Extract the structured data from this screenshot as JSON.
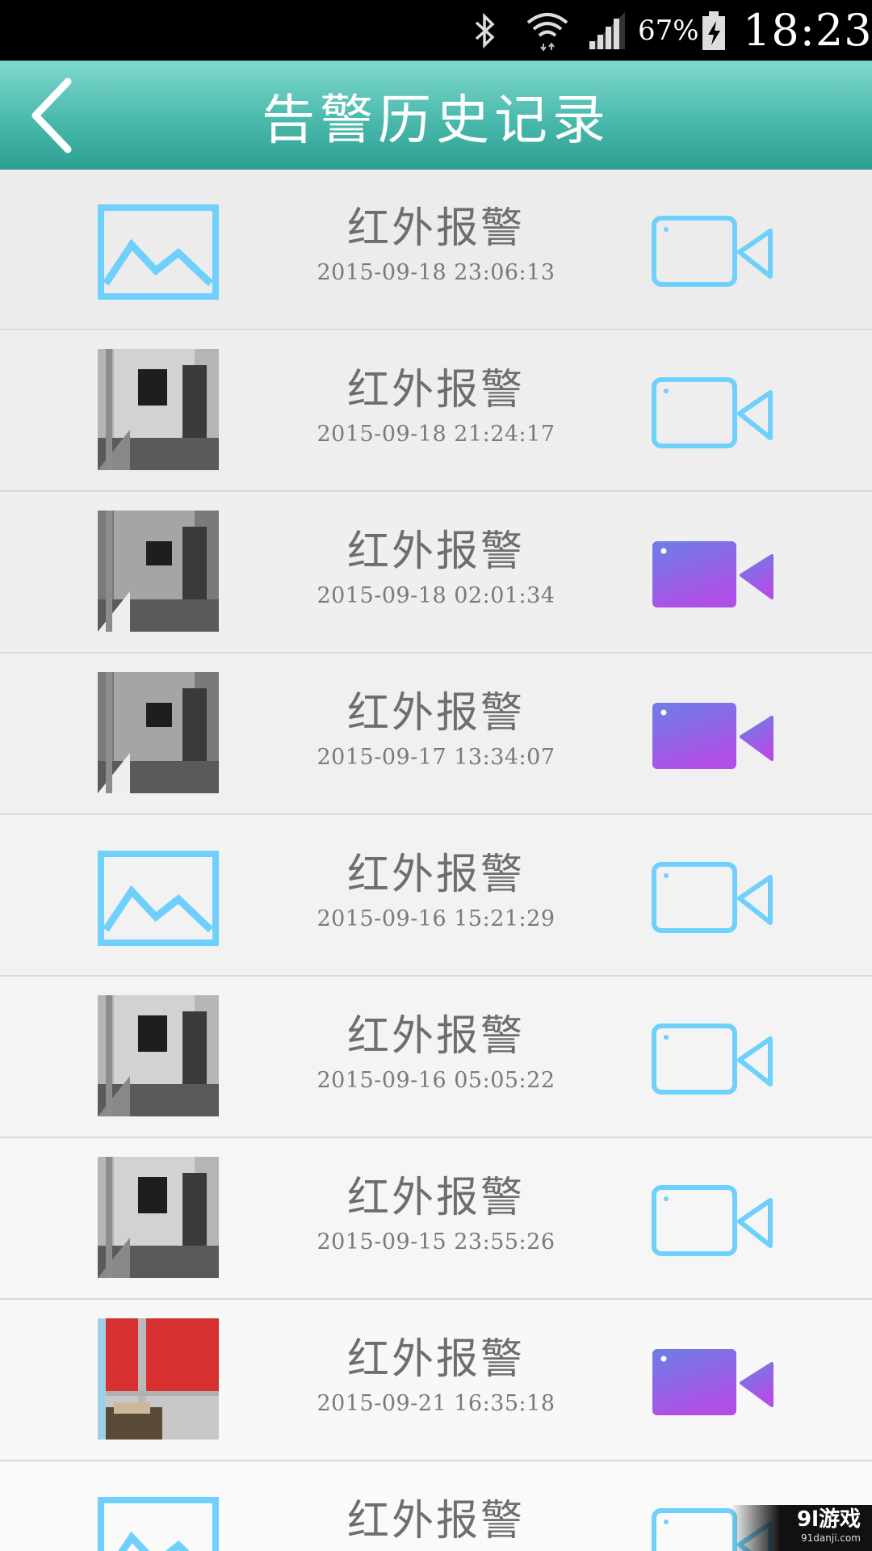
{
  "status_bar": {
    "battery_pct": "67%",
    "time": "18:23",
    "icons": [
      "bluetooth-icon",
      "wifi-icon",
      "signal-icon",
      "battery-charging-icon"
    ]
  },
  "header": {
    "title": "告警历史记录",
    "back_icon": "chevron-left-icon"
  },
  "colors": {
    "header_top": "#7fd9cc",
    "header_bottom": "#2d9f93",
    "icon_blue": "#6fd0fb",
    "video_purple_top": "#6b7fe6",
    "video_purple_bottom": "#b04fe6"
  },
  "alarms": [
    {
      "title": "红外报警",
      "time": "2015-09-18 23:06:13",
      "thumb": "placeholder-image",
      "video": "outline"
    },
    {
      "title": "红外报警",
      "time": "2015-09-18 21:24:17",
      "thumb": "photo-gray",
      "video": "outline"
    },
    {
      "title": "红外报警",
      "time": "2015-09-18 02:01:34",
      "thumb": "photo-dark",
      "video": "filled"
    },
    {
      "title": "红外报警",
      "time": "2015-09-17 13:34:07",
      "thumb": "photo-dark",
      "video": "filled"
    },
    {
      "title": "红外报警",
      "time": "2015-09-16 15:21:29",
      "thumb": "placeholder-image",
      "video": "outline"
    },
    {
      "title": "红外报警",
      "time": "2015-09-16 05:05:22",
      "thumb": "photo-gray",
      "video": "outline"
    },
    {
      "title": "红外报警",
      "time": "2015-09-15 23:55:26",
      "thumb": "photo-gray",
      "video": "outline"
    },
    {
      "title": "红外报警",
      "time": "2015-09-21 16:35:18",
      "thumb": "photo-red",
      "video": "filled"
    },
    {
      "title": "红外报警",
      "time": "",
      "thumb": "placeholder-image",
      "video": "outline"
    }
  ],
  "watermark": {
    "main": "9l游戏",
    "sub": "91danji.com"
  }
}
